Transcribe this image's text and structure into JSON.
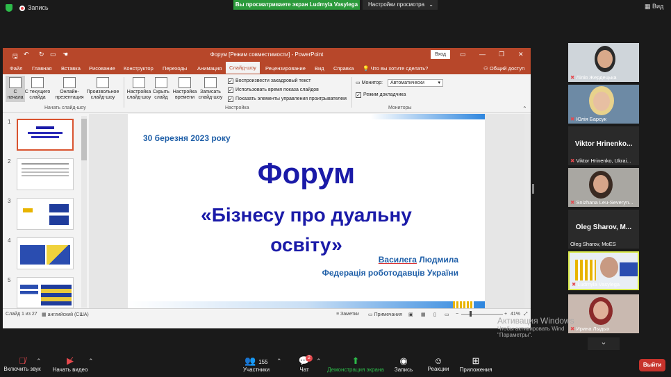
{
  "zoom": {
    "recording_label": "Запись",
    "share_banner": "Вы просматриваете экран Ludmyla Vasylega",
    "view_options": "Настройки просмотра",
    "view_button": "Вид",
    "participants_count": "155",
    "chat_badge": "2",
    "toolbar": {
      "mute": "Включить звук",
      "video": "Начать видео",
      "participants": "Участники",
      "chat": "Чат",
      "share": "Демонстрация экрана",
      "record": "Запись",
      "reactions": "Реакции",
      "apps": "Приложения",
      "end": "Выйти"
    },
    "activation": {
      "title": "Активация Windows",
      "line1": "Чтобы активировать Wind",
      "line2": "\"Параметры\"."
    },
    "participants": [
      {
        "name": "Лілія Жердецька"
      },
      {
        "name": "Юлія Барсук"
      },
      {
        "name": "Viktor Hrinenko, Ukrai...",
        "big": "Viktor Hrinenko..."
      },
      {
        "name": "Snizhana Leu-Severyn..."
      },
      {
        "name": "Oleg Sharov, MoES",
        "big": "Oleg Sharov, M..."
      },
      {
        "name": "Ludmyla Vasylega"
      },
      {
        "name": "Ирина Лыдых"
      }
    ]
  },
  "ppt": {
    "title": "Форум [Режим совместимости] - PowerPoint",
    "login": "Вход",
    "menu": [
      "Файл",
      "Главная",
      "Вставка",
      "Рисование",
      "Конструктор",
      "Переходы",
      "Анимация",
      "Слайд-шоу",
      "Рецензирование",
      "Вид",
      "Справка"
    ],
    "active_menu": "Слайд-шоу",
    "tell_me": "Что вы хотите сделать?",
    "share": "Общий доступ",
    "ribbon": {
      "from_start": [
        "С",
        "начала"
      ],
      "from_current": [
        "С текущего",
        "слайда"
      ],
      "online": [
        "Онлайн-",
        "презентация"
      ],
      "custom": [
        "Произвольное",
        "слайд-шоу"
      ],
      "setup": [
        "Настройка",
        "слайд-шоу"
      ],
      "hide": [
        "Скрыть",
        "слайд"
      ],
      "rehearse": [
        "Настройка",
        "времени"
      ],
      "record": [
        "Записать",
        "слайд-шоу"
      ],
      "group_start": "Начать слайд-шоу",
      "check1": "Воспроизвести закадровый текст",
      "check2": "Использовать время показа слайдов",
      "check3": "Показать элементы управления проигрывателем",
      "group_setup": "Настройка",
      "monitor_label": "Монитор:",
      "monitor_value": "Автоматически",
      "presenter_view": "Режим докладчика",
      "group_monitors": "Мониторы"
    },
    "thumb_numbers": [
      "1",
      "2",
      "3",
      "4",
      "5"
    ],
    "status": {
      "slide": "Слайд 1 из 27",
      "language": "английский (США)",
      "notes": "Заметки",
      "comments": "Примечания",
      "zoom": "41%"
    },
    "slide": {
      "date": "30 березня 2023 року",
      "title": "Форум",
      "subtitle1": "«Бізнесу про дуальну",
      "subtitle2": "освіту»",
      "speaker_first": "Василега",
      "speaker_last": "Людмила",
      "org": "Федерація роботодавців України"
    }
  },
  "colors": {
    "ppt_red": "#b7472a",
    "share_green": "#2b9a3b",
    "slide_blue": "#1a1aa8",
    "speaker_blue": "#1f5fa8",
    "end_red": "#c7332c"
  }
}
